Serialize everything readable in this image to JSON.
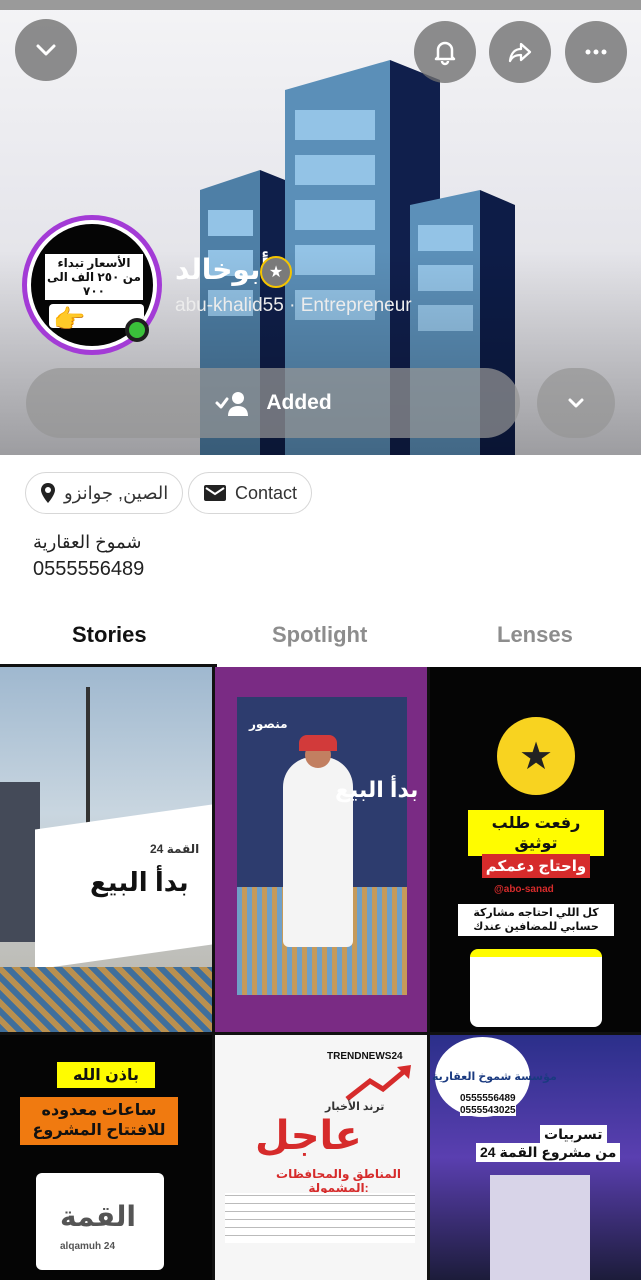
{
  "header": {
    "name": "أبوخالد",
    "username": "abu-khalid55",
    "separator": "·",
    "category": "Entrepreneur",
    "added_label": "Added",
    "avatar_text": "الأسعار تبداء من ٢٥٠ الف الى ٧٠٠",
    "icons": {
      "collapse": "chevron-down-icon",
      "notifications": "bell-icon",
      "share": "share-arrow-icon",
      "more": "more-dots-icon",
      "verified": "star-badge-icon",
      "friend_added": "person-check-icon",
      "dropdown": "chevron-down-icon"
    }
  },
  "info": {
    "location_chip": "الصين, جوانزو",
    "contact_chip": "Contact",
    "bio_line1": "شموخ العقارية",
    "bio_line2": "0555556489"
  },
  "tabs": [
    {
      "label": "Stories",
      "active": true
    },
    {
      "label": "Spotlight",
      "active": false
    },
    {
      "label": "Lenses",
      "active": false
    }
  ],
  "stories": [
    {
      "caption": "بدأ البيع",
      "sub": "القمة 24"
    },
    {
      "caption": "بدأ البيع",
      "sub": "منصور"
    },
    {
      "caption": "رفعت طلب توثيق",
      "sub": "واحتاج دعمكم",
      "extra": "كل اللي احتاجه مشاركة حسابي للمضافين عندك",
      "handle": "@abo-sanad"
    },
    {
      "caption": "باذن الله",
      "sub": "ساعات معدوده للافتتاح المشروع",
      "logo": "القمة",
      "logo_sub": "alqamuh 24"
    },
    {
      "caption": "عاجل",
      "brand": "TRENDNEWS24",
      "sub": "ترند الأخبار",
      "extra": "المناطق والمحافظات المشمولة:"
    },
    {
      "caption": "تسربيات",
      "sub": "من مشروع القمة 24",
      "brand": "مؤسسة شموخ العقارية",
      "phone1": "0555556489",
      "phone2": "0555543025"
    }
  ],
  "colors": {
    "ring": "#a33bd6",
    "online": "#3ac13a",
    "snap_yellow": "#fffc00",
    "accent_red": "#d62b2b"
  }
}
